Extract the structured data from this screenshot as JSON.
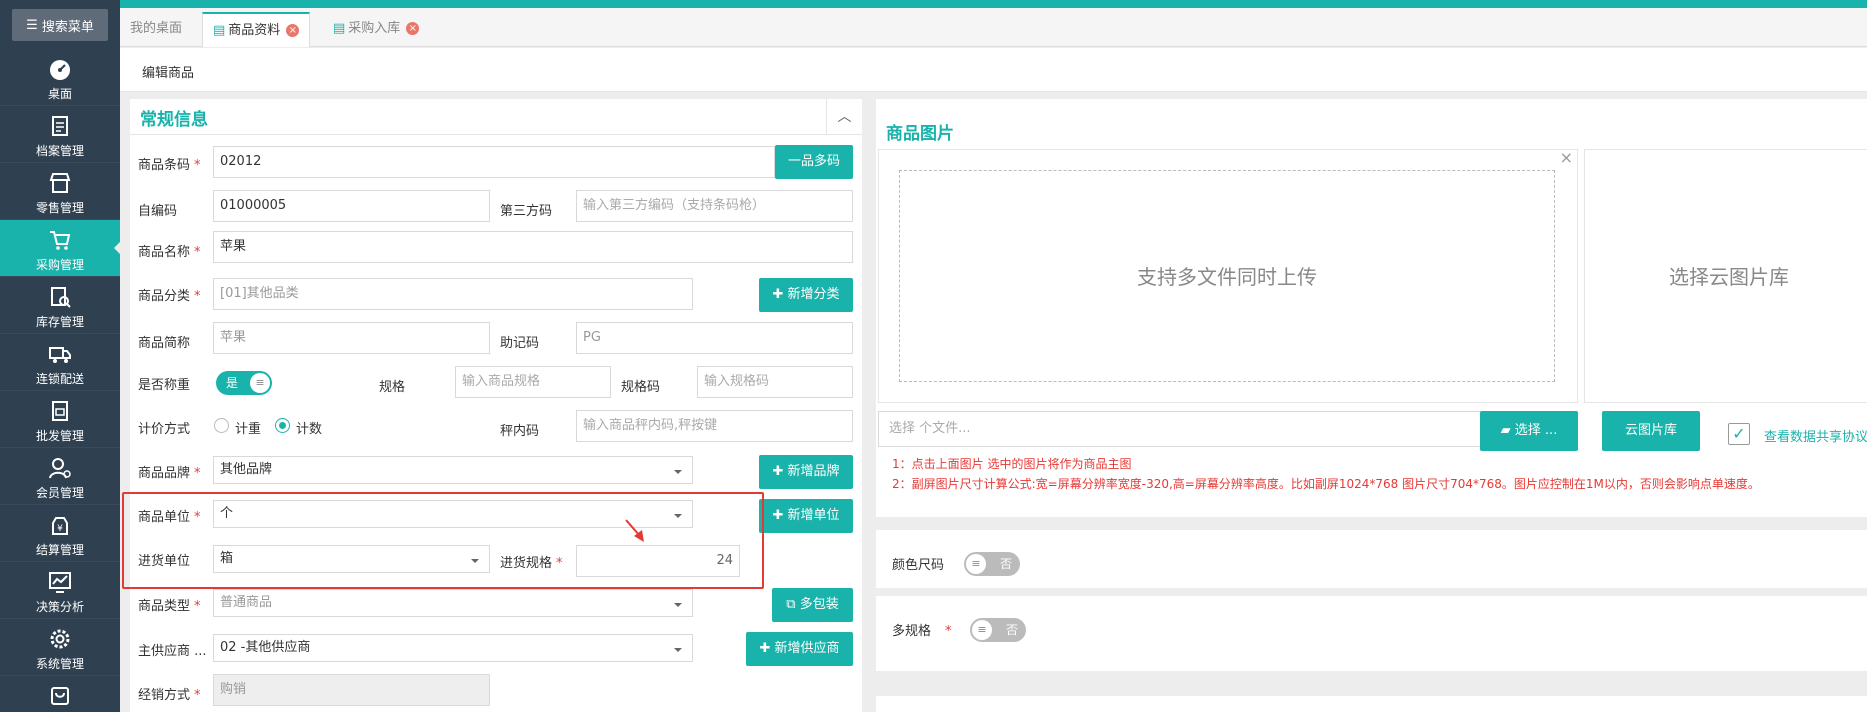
{
  "sidebar": {
    "search_label": "搜索菜单",
    "items": [
      {
        "label": "桌面",
        "icon": "gauge-icon"
      },
      {
        "label": "档案管理",
        "icon": "archive-icon"
      },
      {
        "label": "零售管理",
        "icon": "store-icon"
      },
      {
        "label": "采购管理",
        "icon": "cart-icon"
      },
      {
        "label": "库存管理",
        "icon": "inventory-icon"
      },
      {
        "label": "连锁配送",
        "icon": "truck-icon"
      },
      {
        "label": "批发管理",
        "icon": "wholesale-icon"
      },
      {
        "label": "会员管理",
        "icon": "member-icon"
      },
      {
        "label": "结算管理",
        "icon": "settlement-icon"
      },
      {
        "label": "决策分析",
        "icon": "chart-icon"
      },
      {
        "label": "系统管理",
        "icon": "gear-icon"
      }
    ]
  },
  "tabs": [
    {
      "label": "我的桌面"
    },
    {
      "label": "商品资料"
    },
    {
      "label": "采购入库"
    }
  ],
  "subbar": {
    "title": "编辑商品"
  },
  "form": {
    "section_title": "常规信息",
    "barcode": {
      "label": "商品条码",
      "value": "02012",
      "button": "一品多码"
    },
    "self_code": {
      "label": "自编码",
      "value": "01000005"
    },
    "third_code": {
      "label": "第三方码",
      "placeholder": "输入第三方编码（支持条码枪）"
    },
    "name": {
      "label": "商品名称",
      "value": "苹果"
    },
    "category": {
      "label": "商品分类",
      "value": "[01]其他品类",
      "button": "新增分类"
    },
    "short_name": {
      "label": "商品简称",
      "value": "苹果"
    },
    "mnemonic": {
      "label": "助记码",
      "value": "PG"
    },
    "weighing": {
      "label": "是否称重",
      "toggle": "是"
    },
    "spec": {
      "label": "规格",
      "placeholder": "输入商品规格"
    },
    "spec_code": {
      "label": "规格码",
      "placeholder": "输入规格码"
    },
    "pricing": {
      "label": "计价方式",
      "option1": "计重",
      "option2": "计数",
      "selected": "计数"
    },
    "scale_code": {
      "label": "秤内码",
      "placeholder": "输入商品秤内码,秤按键"
    },
    "brand": {
      "label": "商品品牌",
      "value": "其他品牌",
      "button": "新增品牌"
    },
    "unit": {
      "label": "商品单位",
      "value": "个",
      "button": "新增单位"
    },
    "purchase_unit": {
      "label": "进货单位",
      "value": "箱"
    },
    "purchase_spec": {
      "label": "进货规格",
      "value": "24"
    },
    "product_type": {
      "label": "商品类型",
      "value": "普通商品",
      "button": "多包装"
    },
    "supplier": {
      "label": "主供应商 ...",
      "value": "02 -其他供应商",
      "button": "新增供应商"
    },
    "sale_mode": {
      "label": "经销方式",
      "value": "购销"
    }
  },
  "image_panel": {
    "title": "商品图片",
    "upload_text": "支持多文件同时上传",
    "cloud_text": "选择云图片库",
    "file_placeholder": "选择 个文件...",
    "choose_button": "选择 ...",
    "cloud_button": "云图片库",
    "share_link": "查看数据共享协议",
    "note1": "1：点击上面图片 选中的图片将作为商品主图",
    "note2": "2：副屏图片尺寸计算公式:宽=屏幕分辨率宽度-320,高=屏幕分辨率高度。比如副屏1024*768 图片尺寸704*768。图片应控制在1M以内，否则会影响点单速度。"
  },
  "color_size": {
    "label": "颜色尺码",
    "toggle": "否"
  },
  "multi_spec": {
    "label": "多规格",
    "toggle": "否"
  },
  "colors": {
    "accent": "#1ab3ab",
    "sidebar": "#2f4050",
    "required": "#e53935"
  }
}
